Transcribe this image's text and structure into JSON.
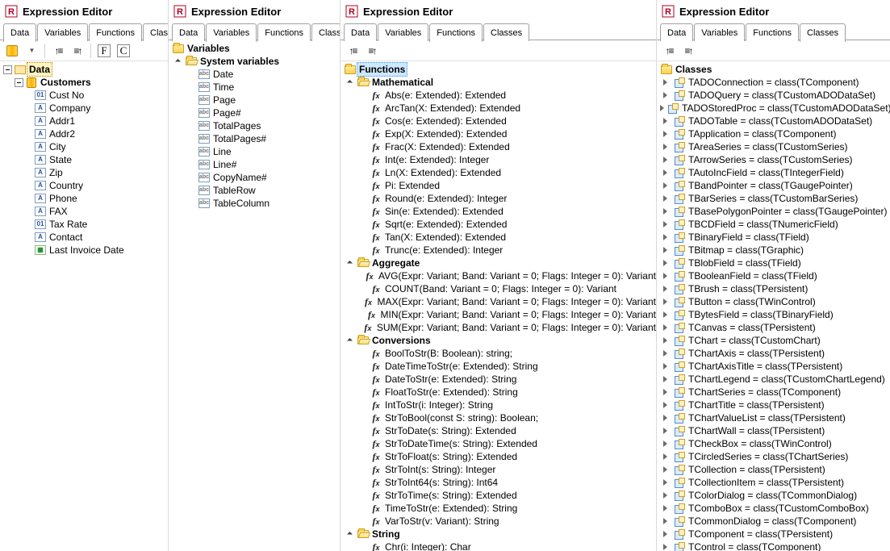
{
  "app_title": "Expression Editor",
  "tabs": [
    "Data",
    "Variables",
    "Functions",
    "Classes"
  ],
  "toolbar": {
    "data_source": "datasource",
    "sort_asc": "sort-asc",
    "sort_group": "sort-grouped",
    "field_label": "F",
    "class_label": "C"
  },
  "panel_data": {
    "root": "Data",
    "group": "Customers",
    "fields": [
      {
        "t": "0",
        "n": "Cust No"
      },
      {
        "t": "A",
        "n": "Company"
      },
      {
        "t": "A",
        "n": "Addr1"
      },
      {
        "t": "A",
        "n": "Addr2"
      },
      {
        "t": "A",
        "n": "City"
      },
      {
        "t": "A",
        "n": "State"
      },
      {
        "t": "A",
        "n": "Zip"
      },
      {
        "t": "A",
        "n": "Country"
      },
      {
        "t": "A",
        "n": "Phone"
      },
      {
        "t": "A",
        "n": "FAX"
      },
      {
        "t": "0",
        "n": "Tax Rate"
      },
      {
        "t": "A",
        "n": "Contact"
      },
      {
        "t": "D",
        "n": "Last Invoice Date"
      }
    ]
  },
  "panel_vars": {
    "root": "Variables",
    "group": "System variables",
    "items": [
      "Date",
      "Time",
      "Page",
      "Page#",
      "TotalPages",
      "TotalPages#",
      "Line",
      "Line#",
      "CopyName#",
      "TableRow",
      "TableColumn"
    ]
  },
  "panel_funcs": {
    "root": "Functions",
    "groups": [
      {
        "name": "Mathematical",
        "items": [
          "Abs(e: Extended): Extended",
          "ArcTan(X: Extended): Extended",
          "Cos(e: Extended): Extended",
          "Exp(X: Extended): Extended",
          "Frac(X: Extended): Extended",
          "Int(e: Extended): Integer",
          "Ln(X: Extended): Extended",
          "Pi: Extended",
          "Round(e: Extended): Integer",
          "Sin(e: Extended): Extended",
          "Sqrt(e: Extended): Extended",
          "Tan(X: Extended): Extended",
          "Trunc(e: Extended): Integer"
        ]
      },
      {
        "name": "Aggregate",
        "items": [
          "AVG(Expr: Variant; Band: Variant = 0; Flags: Integer = 0): Variant",
          "COUNT(Band: Variant = 0; Flags: Integer = 0): Variant",
          "MAX(Expr: Variant; Band: Variant = 0; Flags: Integer = 0): Variant",
          "MIN(Expr: Variant; Band: Variant = 0; Flags: Integer = 0): Variant",
          "SUM(Expr: Variant; Band: Variant = 0; Flags: Integer = 0): Variant"
        ]
      },
      {
        "name": "Conversions",
        "items": [
          "BoolToStr(B: Boolean): string;",
          "DateTimeToStr(e: Extended): String",
          "DateToStr(e: Extended): String",
          "FloatToStr(e: Extended): String",
          "IntToStr(i: Integer): String",
          "StrToBool(const S: string): Boolean;",
          "StrToDate(s: String): Extended",
          "StrToDateTime(s: String): Extended",
          "StrToFloat(s: String): Extended",
          "StrToInt(s: String): Integer",
          "StrToInt64(s: String): Int64",
          "StrToTime(s: String): Extended",
          "TimeToStr(e: Extended): String",
          "VarToStr(v: Variant): String"
        ]
      },
      {
        "name": "String",
        "items": [
          "Chr(i: Integer): Char"
        ]
      }
    ]
  },
  "panel_classes": {
    "root": "Classes",
    "items": [
      "TADOConnection = class(TComponent)",
      "TADOQuery = class(TCustomADODataSet)",
      "TADOStoredProc = class(TCustomADODataSet)",
      "TADOTable = class(TCustomADODataSet)",
      "TApplication = class(TComponent)",
      "TAreaSeries = class(TCustomSeries)",
      "TArrowSeries = class(TCustomSeries)",
      "TAutoIncField = class(TIntegerField)",
      "TBandPointer = class(TGaugePointer)",
      "TBarSeries = class(TCustomBarSeries)",
      "TBasePolygonPointer = class(TGaugePointer)",
      "TBCDField = class(TNumericField)",
      "TBinaryField = class(TField)",
      "TBitmap = class(TGraphic)",
      "TBlobField = class(TField)",
      "TBooleanField = class(TField)",
      "TBrush = class(TPersistent)",
      "TButton = class(TWinControl)",
      "TBytesField = class(TBinaryField)",
      "TCanvas = class(TPersistent)",
      "TChart = class(TCustomChart)",
      "TChartAxis = class(TPersistent)",
      "TChartAxisTitle = class(TPersistent)",
      "TChartLegend = class(TCustomChartLegend)",
      "TChartSeries = class(TComponent)",
      "TChartTitle = class(TPersistent)",
      "TChartValueList = class(TPersistent)",
      "TChartWall = class(TPersistent)",
      "TCheckBox = class(TWinControl)",
      "TCircledSeries = class(TChartSeries)",
      "TCollection = class(TPersistent)",
      "TCollectionItem = class(TPersistent)",
      "TColorDialog = class(TCommonDialog)",
      "TComboBox = class(TCustomComboBox)",
      "TCommonDialog = class(TComponent)",
      "TComponent = class(TPersistent)",
      "TControl = class(TComponent)"
    ]
  }
}
